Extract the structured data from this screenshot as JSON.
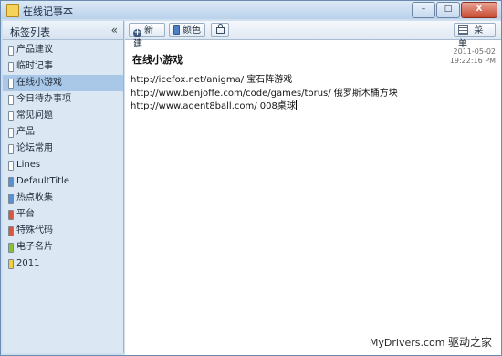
{
  "window": {
    "title": "在线记事本",
    "buttons": {
      "minimize": "–",
      "maximize": "□",
      "close": "X"
    }
  },
  "sidebar": {
    "title": "标签列表",
    "collapse": "«",
    "items": [
      {
        "label": "产品建议",
        "color": "#ffffff"
      },
      {
        "label": "临时记事",
        "color": "#ffffff"
      },
      {
        "label": "在线小游戏",
        "color": "#ffffff",
        "active": true
      },
      {
        "label": "今日待办事项",
        "color": "#ffffff"
      },
      {
        "label": "常见问题",
        "color": "#ffffff"
      },
      {
        "label": "产品",
        "color": "#ffffff"
      },
      {
        "label": "论坛常用",
        "color": "#ffffff"
      },
      {
        "label": "Lines",
        "color": "#ffffff"
      },
      {
        "label": "DefaultTitle",
        "color": "#5a8fd0"
      },
      {
        "label": "热点收集",
        "color": "#5a8fd0"
      },
      {
        "label": "平台",
        "color": "#d9573a"
      },
      {
        "label": "特殊代码",
        "color": "#d9573a"
      },
      {
        "label": "电子名片",
        "color": "#8fbf3a"
      },
      {
        "label": "2011",
        "color": "#f0d040"
      }
    ]
  },
  "toolbar": {
    "new": "新建",
    "color": "颜色",
    "menu": "菜单"
  },
  "note": {
    "title": "在线小游戏",
    "date": "2011-05-02",
    "time": "19:22:16 PM",
    "lines": [
      "http://icefox.net/anigma/ 宝石阵游戏",
      "http://www.benjoffe.com/code/games/torus/ 俄罗斯木桶方块",
      "http://www.agent8ball.com/ 008桌球"
    ]
  },
  "watermark": {
    "site": "MyDrivers.com",
    "brand": "驱动之家"
  }
}
